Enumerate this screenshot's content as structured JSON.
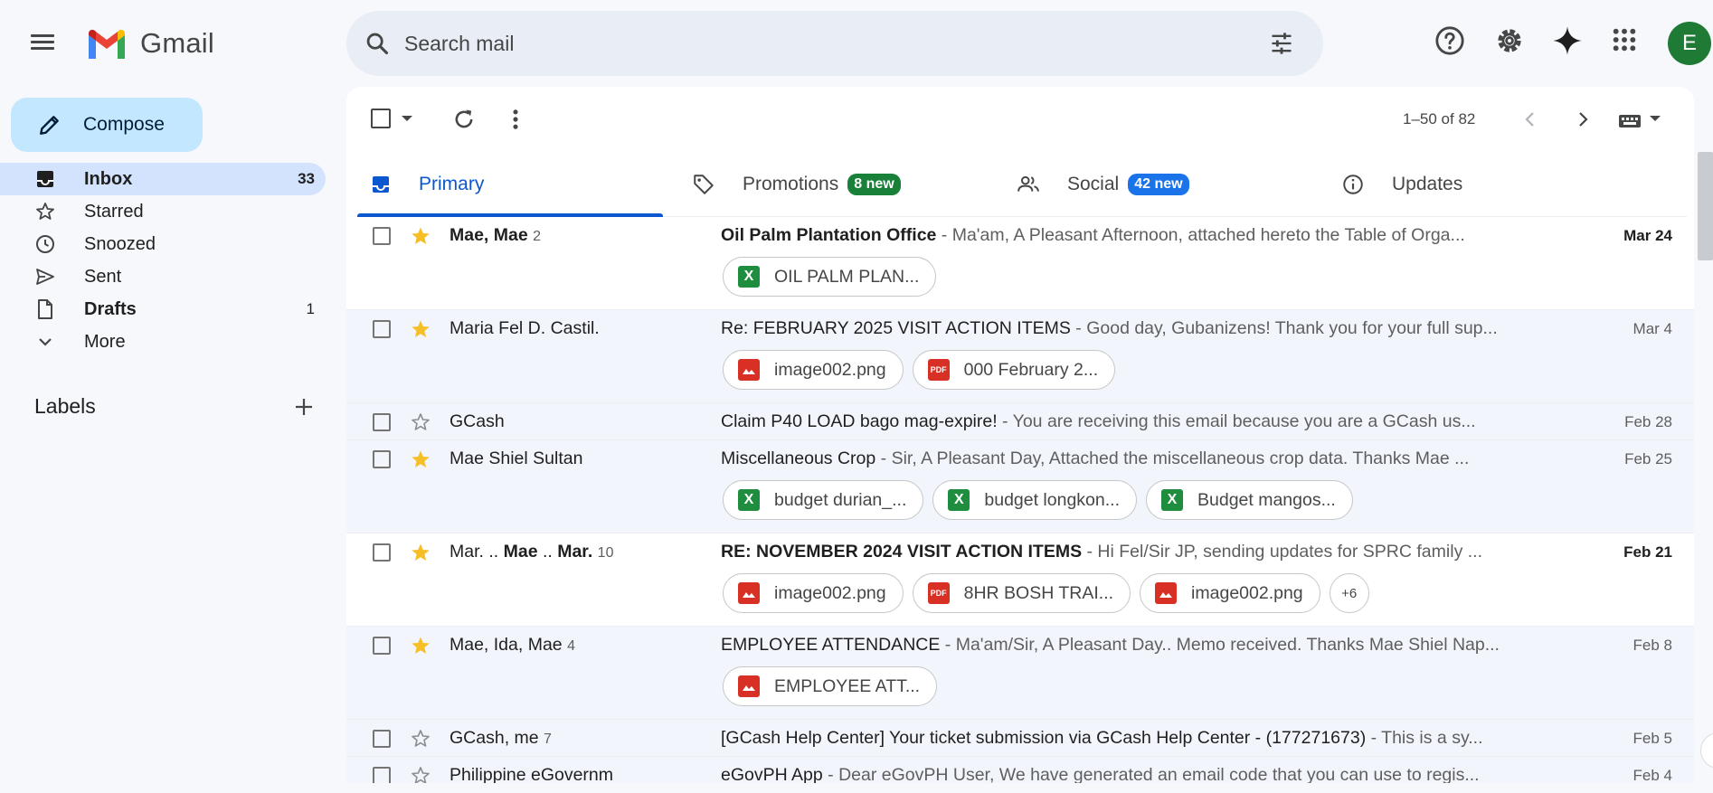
{
  "app": {
    "logo_text": "Gmail",
    "accent": "#0b57d0"
  },
  "search": {
    "placeholder": "Search mail"
  },
  "user": {
    "avatar_letter": "E",
    "avatar_color": "#1e7a34"
  },
  "compose_label": "Compose",
  "nav": [
    {
      "label": "Inbox",
      "count": "33",
      "icon": "inbox-icon",
      "active": true,
      "bold": true
    },
    {
      "label": "Starred",
      "count": "",
      "icon": "star-icon",
      "active": false,
      "bold": false
    },
    {
      "label": "Snoozed",
      "count": "",
      "icon": "clock-icon",
      "active": false,
      "bold": false
    },
    {
      "label": "Sent",
      "count": "",
      "icon": "send-icon",
      "active": false,
      "bold": false
    },
    {
      "label": "Drafts",
      "count": "1",
      "icon": "draft-icon",
      "active": false,
      "bold": true
    },
    {
      "label": "More",
      "count": "",
      "icon": "chevron-down-icon",
      "active": false,
      "bold": false
    }
  ],
  "labels_title": "Labels",
  "pagination": "1–50 of 82",
  "tabs": [
    {
      "label": "Primary",
      "badge": "",
      "badge_color": "",
      "icon": "inbox-icon"
    },
    {
      "label": "Promotions",
      "badge": "8 new",
      "badge_color": "#188038",
      "icon": "tag-icon"
    },
    {
      "label": "Social",
      "badge": "42 new",
      "badge_color": "#1a73e8",
      "icon": "people-icon"
    },
    {
      "label": "Updates",
      "badge": "",
      "badge_color": "",
      "icon": "info-icon"
    }
  ],
  "emails": [
    {
      "unread": true,
      "starred": true,
      "sender_parts": [
        {
          "t": "Mae, Mae",
          "b": true
        }
      ],
      "count": "2",
      "subject": "Oil Palm Plantation Office",
      "snippet": " - Ma'am, A Pleasant Afternoon, attached hereto the Table of Orga...",
      "date": "Mar 24",
      "attachments": [
        {
          "type": "xls",
          "name": "OIL PALM PLAN..."
        }
      ],
      "more": ""
    },
    {
      "unread": false,
      "starred": true,
      "sender_parts": [
        {
          "t": "Maria Fel D. Castil.",
          "b": false
        }
      ],
      "count": "",
      "subject": "Re: FEBRUARY 2025 VISIT ACTION ITEMS",
      "snippet": " - Good day, Gubanizens! Thank you for your full sup...",
      "date": "Mar 4",
      "attachments": [
        {
          "type": "img",
          "name": "image002.png"
        },
        {
          "type": "pdf",
          "name": "000 February 2..."
        }
      ],
      "more": ""
    },
    {
      "unread": false,
      "starred": false,
      "sender_parts": [
        {
          "t": "GCash",
          "b": false
        }
      ],
      "count": "",
      "subject": "Claim P40 LOAD bago mag-expire!",
      "snippet": " - You are receiving this email because you are a GCash us...",
      "date": "Feb 28",
      "attachments": [],
      "more": ""
    },
    {
      "unread": false,
      "starred": true,
      "sender_parts": [
        {
          "t": "Mae Shiel Sultan",
          "b": false
        }
      ],
      "count": "",
      "subject": "Miscellaneous Crop",
      "snippet": " - Sir, A Pleasant Day, Attached the miscellaneous crop data. Thanks Mae ...",
      "date": "Feb 25",
      "attachments": [
        {
          "type": "xls",
          "name": "budget durian_..."
        },
        {
          "type": "xls",
          "name": "budget longkon..."
        },
        {
          "type": "xls",
          "name": "Budget mangos..."
        }
      ],
      "more": ""
    },
    {
      "unread": true,
      "starred": true,
      "sender_parts": [
        {
          "t": "Mar. .. ",
          "b": false
        },
        {
          "t": "Mae",
          "b": true
        },
        {
          "t": " .. ",
          "b": false
        },
        {
          "t": "Mar.",
          "b": true
        }
      ],
      "count": "10",
      "subject": "RE: NOVEMBER 2024 VISIT ACTION ITEMS",
      "snippet": " - Hi Fel/Sir JP, sending updates for SPRC family ...",
      "date": "Feb 21",
      "attachments": [
        {
          "type": "img",
          "name": "image002.png"
        },
        {
          "type": "pdf",
          "name": "8HR BOSH TRAI..."
        },
        {
          "type": "img",
          "name": "image002.png"
        }
      ],
      "more": "+6"
    },
    {
      "unread": false,
      "starred": true,
      "sender_parts": [
        {
          "t": "Mae, Ida, Mae",
          "b": false
        }
      ],
      "count": "4",
      "subject": "EMPLOYEE ATTENDANCE",
      "snippet": " - Ma'am/Sir, A Pleasant Day.. Memo received. Thanks Mae Shiel Nap...",
      "date": "Feb 8",
      "attachments": [
        {
          "type": "img",
          "name": "EMPLOYEE ATT..."
        }
      ],
      "more": ""
    },
    {
      "unread": false,
      "starred": false,
      "sender_parts": [
        {
          "t": "GCash, me",
          "b": false
        }
      ],
      "count": "7",
      "subject": "[GCash Help Center] Your ticket submission via GCash Help Center - (177271673)",
      "snippet": " - This is a sy...",
      "date": "Feb 5",
      "attachments": [],
      "more": ""
    },
    {
      "unread": false,
      "starred": false,
      "sender_parts": [
        {
          "t": "Philippine eGovernm",
          "b": false
        }
      ],
      "count": "",
      "subject": "eGovPH App",
      "snippet": " - Dear eGovPH User, We have generated an email code that you can use to regis...",
      "date": "Feb 4",
      "attachments": [],
      "more": ""
    }
  ]
}
